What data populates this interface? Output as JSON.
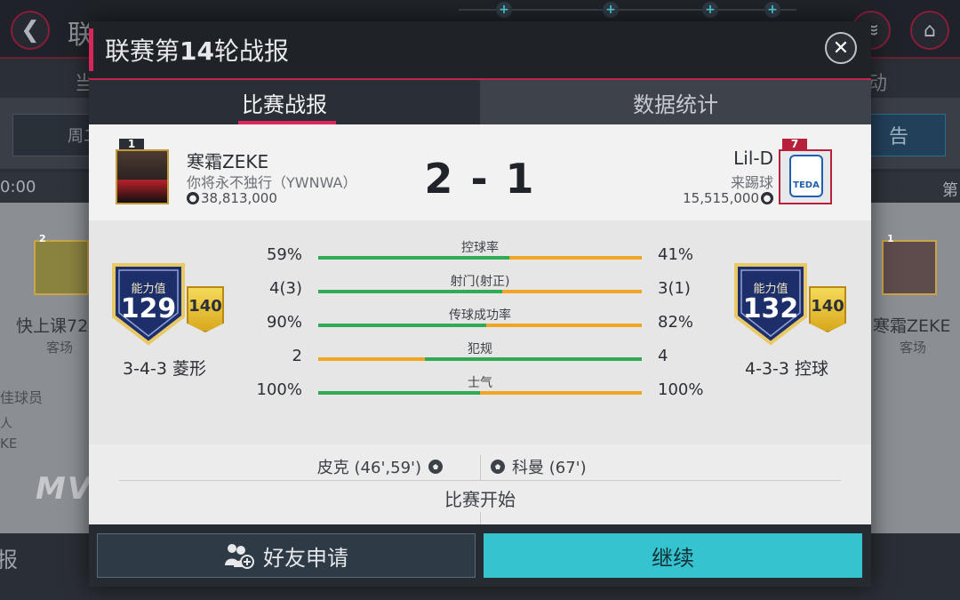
{
  "background": {
    "title": "联",
    "tab_left": "当",
    "tab_right": "动",
    "pill_left": "周二",
    "pill_right": "告",
    "time": "0:00",
    "round_prefix": "第",
    "left_card_number": "2",
    "left_team": "快上课72",
    "left_venue": "客场",
    "right_card_number": "1",
    "right_team": "寒霜ZEKE",
    "right_venue": "客场",
    "side_line1": "佳球员",
    "side_line2": "人",
    "side_line3": "KE",
    "mvp": "MV",
    "bottom_left": "报"
  },
  "modal": {
    "title_prefix": "联赛第",
    "title_number": "14",
    "title_suffix": "轮战报",
    "close_icon": "close-icon"
  },
  "tabs": [
    {
      "label": "比赛战报",
      "active": true
    },
    {
      "label": "数据统计",
      "active": false
    }
  ],
  "home": {
    "card_number": "1",
    "name": "寒霜ZEKE",
    "club": "你将永不独行（YWNWA）",
    "value": "38,813,000",
    "rating_label": "能力值",
    "rating": "129",
    "tag": "140",
    "formation": "3-4-3 菱形",
    "scorers": "皮克 (46',59')"
  },
  "away": {
    "card_number": "7",
    "name": "Lil-D",
    "club": "来踢球",
    "value": "15,515,000",
    "rating_label": "能力值",
    "rating": "132",
    "tag": "140",
    "formation": "4-3-3 控球",
    "scorers": "科曼 (67')",
    "crest_text": "TEDA"
  },
  "score": "2 - 1",
  "stats": [
    {
      "label": "控球率",
      "home": "59%",
      "away": "41%",
      "home_share": 0.59
    },
    {
      "label": "射门(射正)",
      "home": "4(3)",
      "away": "3(1)",
      "home_share": 0.57
    },
    {
      "label": "传球成功率",
      "home": "90%",
      "away": "82%",
      "home_share": 0.52
    },
    {
      "label": "犯规",
      "home": "2",
      "away": "4",
      "home_share": 0.33
    },
    {
      "label": "士气",
      "home": "100%",
      "away": "100%",
      "home_share": 0.5
    }
  ],
  "kickoff": "比赛开始",
  "buttons": {
    "friend": "好友申请",
    "continue": "继续"
  },
  "colors": {
    "accent": "#d6265a",
    "home_bar": "#2faa55",
    "away_bar": "#f0a623",
    "continue_button": "#35c3d0"
  }
}
